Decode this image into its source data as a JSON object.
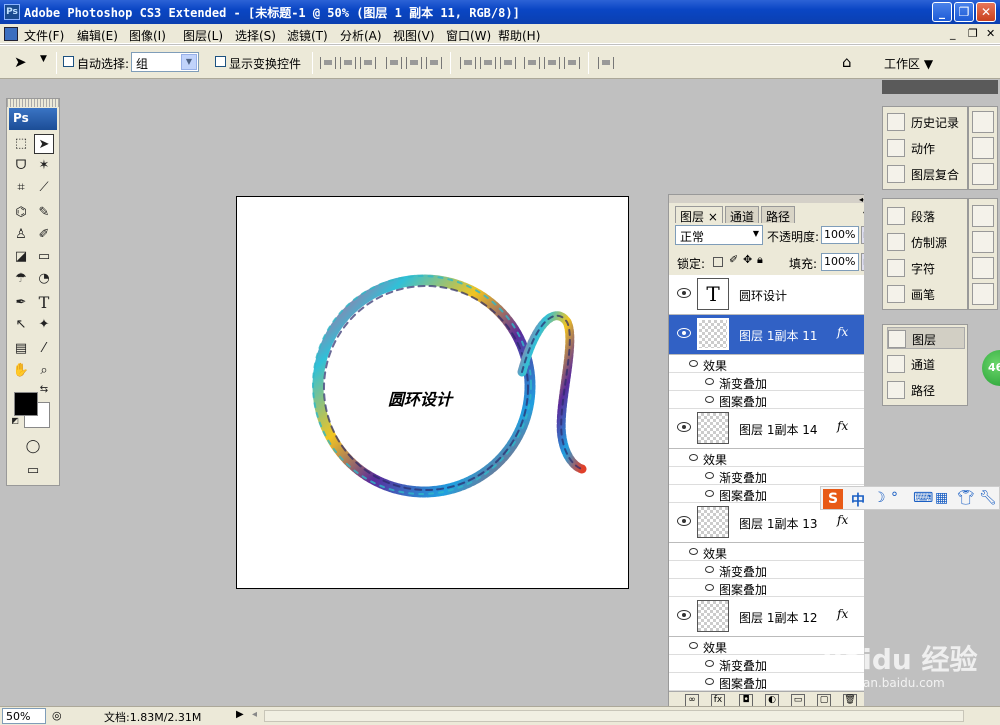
{
  "window": {
    "title": "Adobe Photoshop CS3 Extended - [未标题-1 @ 50% (图层 1 副本 11, RGB/8)]",
    "app_icon": "Ps"
  },
  "menu": {
    "items": [
      "文件(F)",
      "编辑(E)",
      "图像(I)",
      "图层(L)",
      "选择(S)",
      "滤镜(T)",
      "分析(A)",
      "视图(V)",
      "窗口(W)",
      "帮助(H)"
    ]
  },
  "options": {
    "auto_select_label": "自动选择:",
    "auto_select_value": "组",
    "show_transform_label": "显示变换控件",
    "workspace_label": "工作区"
  },
  "tools": {
    "logo": "Ps",
    "icons": [
      "marquee-icon",
      "move-icon",
      "lasso-icon",
      "magic-wand-icon",
      "crop-icon",
      "eyedropper-icon",
      "spot-healing-icon",
      "brush-icon",
      "clone-stamp-icon",
      "history-brush-icon",
      "eraser-icon",
      "gradient-icon",
      "blur-icon",
      "dodge-icon",
      "pen-icon",
      "type-icon",
      "path-selection-icon",
      "shape-icon",
      "notes-icon",
      "eyedropper2-icon",
      "hand-icon",
      "zoom-icon"
    ],
    "type_glyph": "T",
    "foreground_color": "#000000",
    "background_color": "#ffffff"
  },
  "canvas": {
    "text": "圆环设计"
  },
  "layers_panel": {
    "tabs": [
      "图层",
      "通道",
      "路径"
    ],
    "blend_mode": "正常",
    "opacity_label": "不透明度:",
    "opacity_value": "100%",
    "lock_label": "锁定:",
    "fill_label": "填充:",
    "fill_value": "100%",
    "layers": [
      {
        "name": "圆环设计",
        "type": "text"
      },
      {
        "name": "图层 1副本 11",
        "selected": true,
        "fx": "fx"
      },
      {
        "name": "图层 1副本 14",
        "fx": "fx"
      },
      {
        "name": "图层 1副本 13",
        "fx": "fx"
      },
      {
        "name": "图层 1副本 12",
        "fx": "fx"
      }
    ],
    "effects_label": "效果",
    "gradient_overlay": "渐变叠加",
    "pattern_overlay": "图案叠加",
    "text_thumb": "T"
  },
  "dock": {
    "group1": [
      "历史记录",
      "动作",
      "图层复合"
    ],
    "group2": [
      "段落",
      "仿制源",
      "字符",
      "画笔"
    ],
    "group3": [
      "图层",
      "通道",
      "路径"
    ]
  },
  "statusbar": {
    "zoom": "50%",
    "doc_info": "文档:1.83M/2.31M"
  },
  "ime": {
    "logo": "S",
    "mode": "中"
  },
  "badge": "46",
  "watermark": {
    "brand": "Baidu 经验",
    "url": "jingyan.baidu.com"
  }
}
